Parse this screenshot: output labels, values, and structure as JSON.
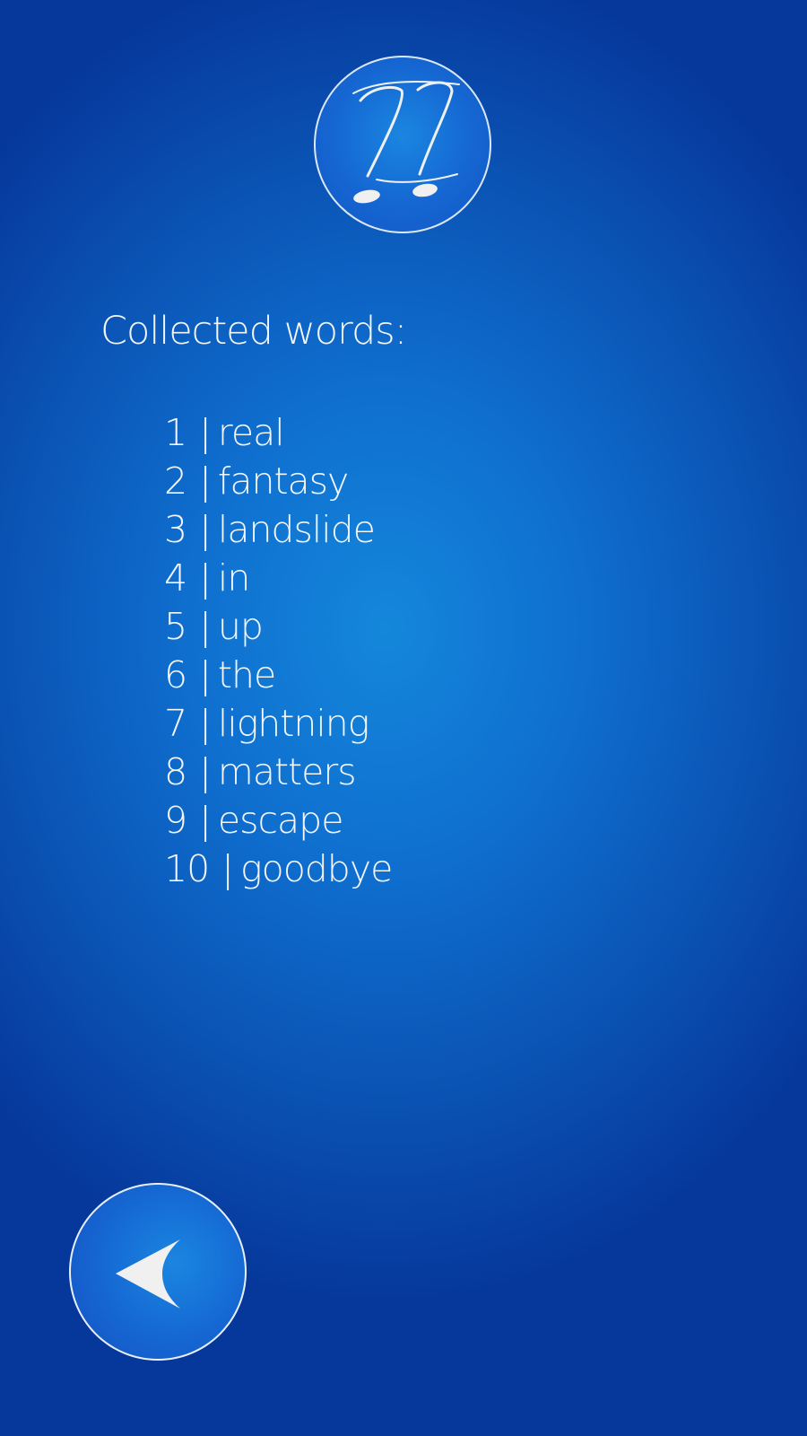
{
  "colors": {
    "background_center": "#1487db",
    "background_edge": "#06379a",
    "text": "#f2f6fb",
    "icon_fill": "#f0f0f0"
  },
  "header": {
    "logo_icon": "double-quote-music-note-icon"
  },
  "collected": {
    "heading": "Collected words:",
    "items": [
      {
        "number": "1",
        "sep": "|",
        "word": "real"
      },
      {
        "number": "2",
        "sep": "|",
        "word": "fantasy"
      },
      {
        "number": "3",
        "sep": "|",
        "word": "landslide"
      },
      {
        "number": "4",
        "sep": "|",
        "word": "in"
      },
      {
        "number": "5",
        "sep": "|",
        "word": "up"
      },
      {
        "number": "6",
        "sep": "|",
        "word": "the"
      },
      {
        "number": "7",
        "sep": "|",
        "word": "lightning"
      },
      {
        "number": "8",
        "sep": "|",
        "word": "matters"
      },
      {
        "number": "9",
        "sep": "|",
        "word": "escape"
      },
      {
        "number": "10",
        "sep": "|",
        "word": "goodbye"
      }
    ]
  },
  "footer": {
    "back_icon": "back-arrow-icon"
  }
}
